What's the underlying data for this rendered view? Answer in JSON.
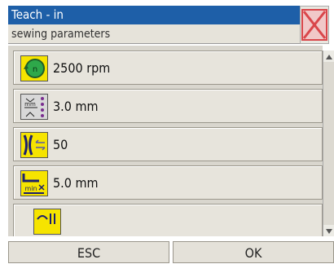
{
  "header": {
    "title": "Teach - in",
    "subtitle": "sewing parameters"
  },
  "close": {
    "icon": "close-x-icon",
    "color": "#d9464a"
  },
  "list": {
    "items": [
      {
        "label": "2500 rpm",
        "icon": "motor-speed-icon",
        "icon_bg": "#f6e400"
      },
      {
        "label": "3.0 mm",
        "icon": "stitch-length-icon",
        "icon_bg": "#d8d8d8"
      },
      {
        "label": "50",
        "icon": "thread-tension-icon",
        "icon_bg": "#f6e400"
      },
      {
        "label": "5.0 mm",
        "icon": "foot-lift-icon",
        "icon_bg": "#f6e400"
      },
      {
        "label": "",
        "icon": "thread-cutter-icon",
        "icon_bg": "#f6e400"
      }
    ]
  },
  "footer": {
    "esc_label": "ESC",
    "ok_label": "OK"
  }
}
